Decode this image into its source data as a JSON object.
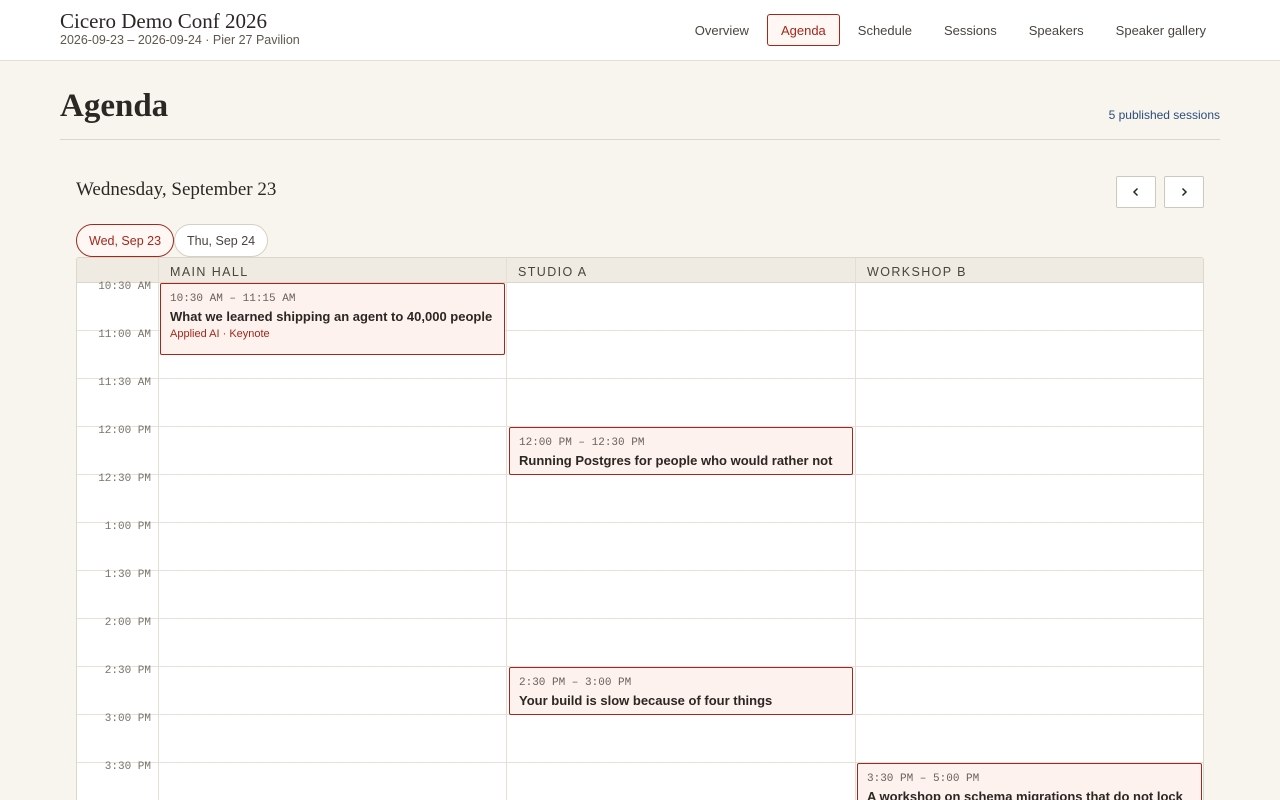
{
  "header": {
    "title": "Cicero Demo Conf 2026",
    "subtitle": "2026-09-23 – 2026-09-24 · Pier 27 Pavilion"
  },
  "nav": [
    "Overview",
    "Agenda",
    "Schedule",
    "Sessions",
    "Speakers",
    "Speaker gallery"
  ],
  "nav_active": "Agenda",
  "page": {
    "title": "Agenda",
    "published_count": "5 published sessions"
  },
  "day_view": {
    "title": "Wednesday, September 23",
    "prev_icon": "chevron-left-icon",
    "next_icon": "chevron-right-icon",
    "tabs": [
      "Wed, Sep 23",
      "Thu, Sep 24"
    ],
    "active_tab": "Wed, Sep 23"
  },
  "rooms": [
    "MAIN HALL",
    "STUDIO A",
    "WORKSHOP B"
  ],
  "time_slots": [
    "10:30 AM",
    "11:00 AM",
    "11:30 AM",
    "12:00 PM",
    "12:30 PM",
    "1:00 PM",
    "1:30 PM",
    "2:00 PM",
    "2:30 PM",
    "3:00 PM",
    "3:30 PM"
  ],
  "sessions": [
    {
      "room": "MAIN HALL",
      "time": "10:30 AM – 11:15 AM",
      "title": "What we learned shipping an agent to 40,000 people",
      "tags": "Applied AI · Keynote"
    },
    {
      "room": "STUDIO A",
      "time": "12:00 PM – 12:30 PM",
      "title": "Running Postgres for people who would rather not",
      "tags": ""
    },
    {
      "room": "STUDIO A",
      "time": "2:30 PM – 3:00 PM",
      "title": "Your build is slow because of four things",
      "tags": ""
    },
    {
      "room": "WORKSHOP B",
      "time": "3:30 PM – 5:00 PM",
      "title": "A workshop on schema migrations that do not lock",
      "tags": ""
    }
  ],
  "colors": {
    "accent": "#a3281b",
    "session_bg": "#fdf2ee",
    "link": "#2c4d7a",
    "page_bg": "#f8f5ef"
  }
}
